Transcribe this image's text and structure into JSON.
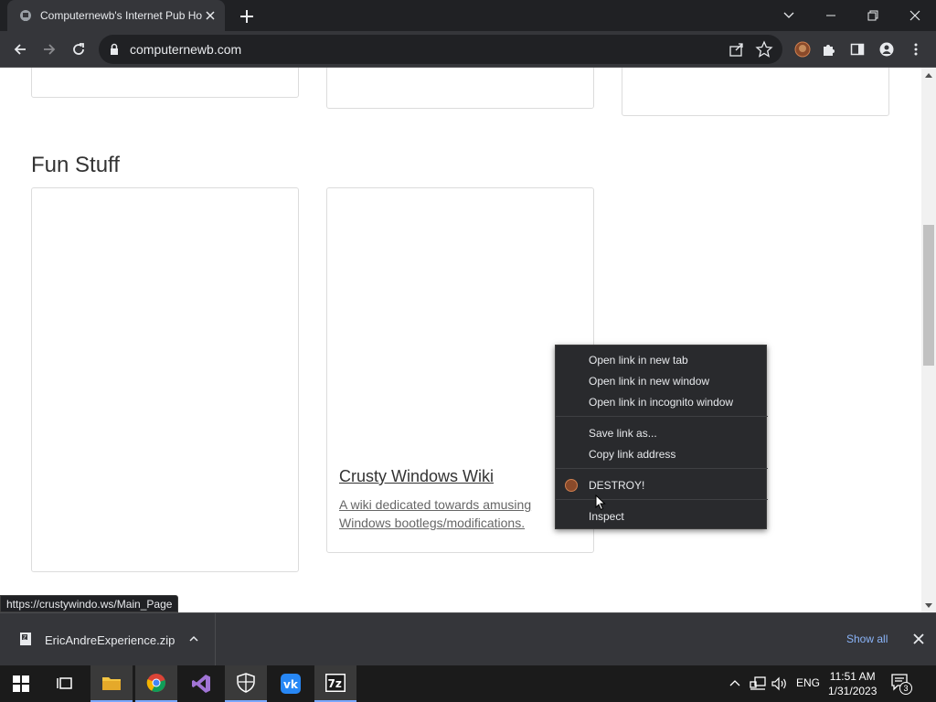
{
  "browser": {
    "tab_title": "Computernewb's Internet Pub Ho",
    "url": "computernewb.com"
  },
  "page": {
    "section_title": "Fun Stuff",
    "card_title": "Crusty Windows Wiki",
    "card_desc": "A wiki dedicated towards amusing Windows bootlegs/modifications."
  },
  "status_url": "https://crustywindo.ws/Main_Page",
  "context_menu": {
    "items": [
      "Open link in new tab",
      "Open link in new window",
      "Open link in incognito window",
      "Save link as...",
      "Copy link address",
      "DESTROY!",
      "Inspect"
    ]
  },
  "download_bar": {
    "file": "EricAndreExperience.zip",
    "show_all": "Show all"
  },
  "taskbar": {
    "language": "ENG",
    "time": "11:51 AM",
    "date": "1/31/2023",
    "notification_count": "3"
  },
  "colors": {
    "chrome_dark": "#202124",
    "toolbar": "#35363a",
    "link_blue": "#8ab4f8",
    "taskbar": "#1b1b1b"
  }
}
